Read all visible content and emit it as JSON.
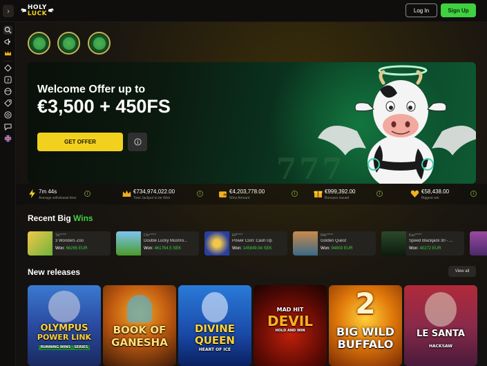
{
  "header": {
    "logo_text_top": "HOLY",
    "logo_text_bottom": "LUCK",
    "expand_icon": "chevron-right-icon",
    "login_label": "Log In",
    "signup_label": "Sign Up",
    "signup_color": "#3fd13f"
  },
  "sidebar": {
    "icons": [
      "search-icon",
      "megaphone-icon",
      "crown-icon",
      "diamond-icon",
      "slots-icon",
      "ball-icon",
      "tag-icon",
      "casino-chip-icon",
      "chat-icon",
      "flag-uk-icon"
    ]
  },
  "hero": {
    "line1": "Welcome Offer up to",
    "line2": "€3,500 + 450FS",
    "cta_label": "GET OFFER",
    "cta_color": "#f2d11e",
    "info_icon": "info-icon"
  },
  "stats": [
    {
      "icon": "lightning-icon",
      "value": "7m 44s",
      "label": "Average withdrawal time"
    },
    {
      "icon": "crown-icon",
      "value": "€734,974,022.00",
      "label": "Total Jackpot to be Won"
    },
    {
      "icon": "wallet-icon",
      "value": "€4,203,778.00",
      "label": "Wins Amount"
    },
    {
      "icon": "gift-icon",
      "value": "€999,392.00",
      "label": "Bonuses issued"
    },
    {
      "icon": "heart-icon",
      "value": "€58,438.00",
      "label": "Biggest win"
    }
  ],
  "recent_wins": {
    "title_prefix": "Recent Big ",
    "title_accent": "Wins",
    "won_label": "Won:",
    "items": [
      {
        "user": "Tal*****",
        "game": "3 Wonders Zoo",
        "amount": "66265 EUR"
      },
      {
        "user": "Chr*****",
        "game": "Double Lucky Mushro...",
        "amount": "461764.5 SEK"
      },
      {
        "user": "Ell*****",
        "game": "Power Coin: Cash Up",
        "amount": "145849.94 SEK"
      },
      {
        "user": "Nile*****",
        "game": "Golden Quest",
        "amount": "94803 EUR"
      },
      {
        "user": "Kaz*****",
        "game": "Speed Blackjack 30 - ...",
        "amount": "40272 EUR"
      }
    ]
  },
  "new_releases": {
    "title": "New releases",
    "view_all_label": "View all",
    "games": [
      {
        "title_line1": "OLYMPUS",
        "title_line2": "POWER LINK",
        "subtitle": "RUNNING WINS · SERIES"
      },
      {
        "title_line1": "BOOK OF",
        "title_line2": "GANESHA",
        "subtitle": ""
      },
      {
        "title_line1": "DIVINE",
        "title_line2": "QUEEN",
        "subtitle": "HEART OF ICE"
      },
      {
        "title_line1": "MAD HIT",
        "title_line2": "DEVIL",
        "subtitle": "HOLD AND WIN"
      },
      {
        "title_line1": "BIG WILD",
        "title_line2": "BUFFALO",
        "subtitle": "2"
      },
      {
        "title_line1": "LE SANTA",
        "title_line2": "HACKSAW",
        "subtitle": ""
      }
    ]
  }
}
